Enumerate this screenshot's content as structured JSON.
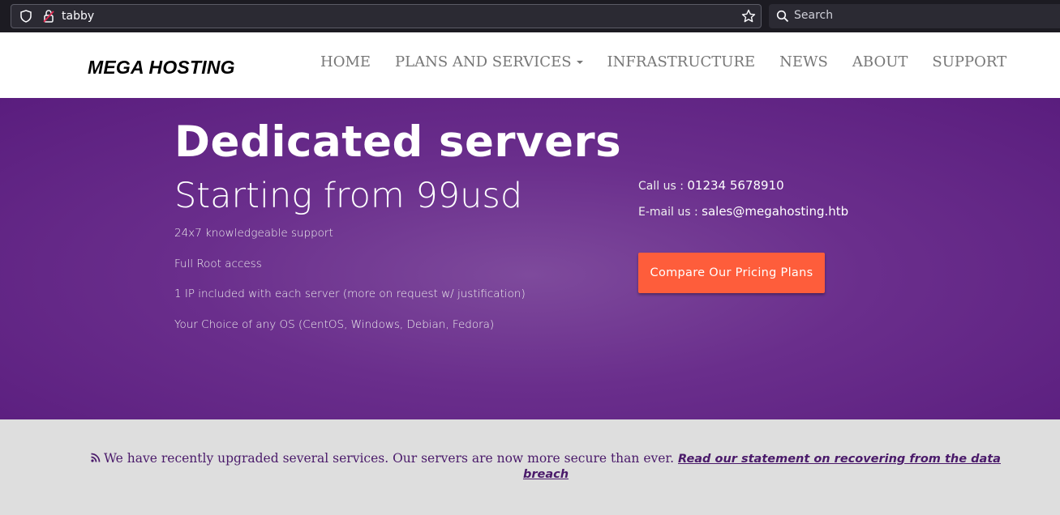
{
  "browser": {
    "url": "tabby",
    "search_placeholder": "Search"
  },
  "site": {
    "logo": "MEGA HOSTING",
    "nav": [
      {
        "label": "HOME"
      },
      {
        "label": "PLANS AND SERVICES",
        "dropdown": true
      },
      {
        "label": "INFRASTRUCTURE"
      },
      {
        "label": "NEWS"
      },
      {
        "label": "ABOUT"
      },
      {
        "label": "SUPPORT"
      }
    ]
  },
  "hero": {
    "title": "Dedicated servers",
    "subtitle": "Starting from 99usd",
    "features": [
      "24x7 knowledgeable support",
      "Full Root access",
      "1 IP included with each server (more on request w/ justification)",
      "Your Choice of any OS (CentOS, Windows, Debian, Fedora)"
    ],
    "call_label": "Call us : ",
    "call_value": "01234 5678910",
    "email_label": "E-mail us : ",
    "email_value": "sales@megahosting.htb",
    "cta_label": "Compare Our Pricing Plans"
  },
  "notice": {
    "text": "We have recently upgraded several services. Our servers are now more secure than ever.",
    "link_text": "Read our statement on recovering from the data breach"
  },
  "colors": {
    "hero_bg": "#6a2e8c",
    "cta_bg": "#fe5d3b",
    "notice_text": "#4a1a6a"
  }
}
